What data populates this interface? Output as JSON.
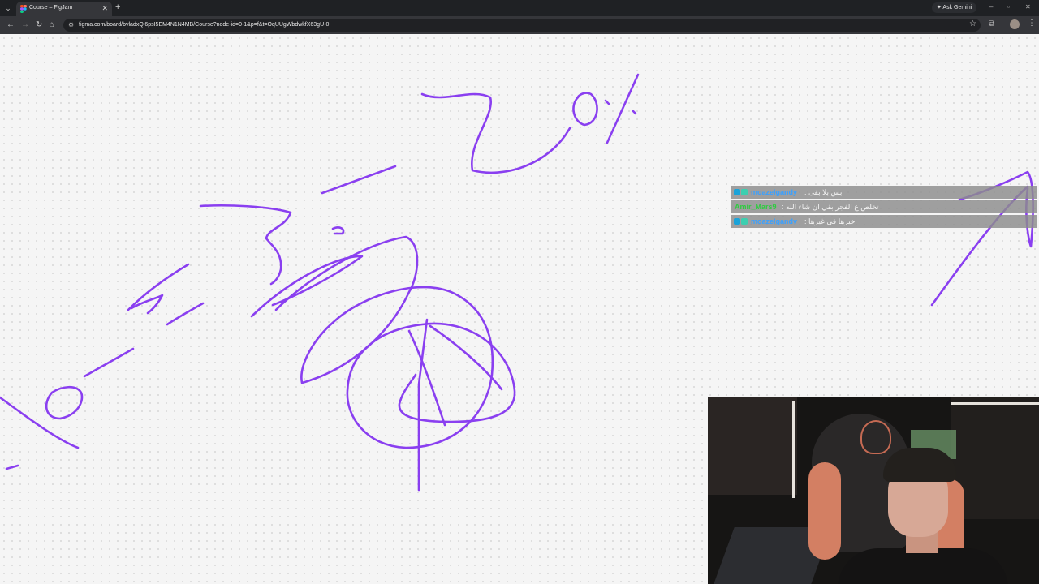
{
  "browser": {
    "tab_title": "Course – FigJam",
    "new_tab_label": "+",
    "tab_close": "✕",
    "gemini_label": "✦ Ask Gemini",
    "url": "figma.com/board/bvladxQl6psI5EM4N1N4MB/Course?node-id=0-1&p=f&t=OqUUgWbdwkfX63gU-0",
    "window_controls": {
      "minimize": "–",
      "maximize": "▫",
      "close": "✕"
    },
    "icons": [
      "menu-icon",
      "figjam-icon",
      "back-icon",
      "forward-icon",
      "reload-icon",
      "home-icon",
      "site-info-icon",
      "star-icon",
      "extensions-icon",
      "profile-icon",
      "more-icon"
    ]
  },
  "chat": {
    "messages": [
      {
        "user": "moazelgandy",
        "user_color": "#3aa0ff",
        "text": ": بس بلا بقى"
      },
      {
        "user": "Amir_Mars9",
        "user_color": "#2ecc40",
        "text": ": تخلص ع الفجر بقي ان شاء الله"
      },
      {
        "user": "moazelgandy",
        "user_color": "#3aa0ff",
        "text": ": خيرها في غيرها"
      }
    ]
  },
  "colors": {
    "ink": "#8a3ff0",
    "canvas": "#f5f5f5",
    "tabbar": "#1f2124"
  }
}
